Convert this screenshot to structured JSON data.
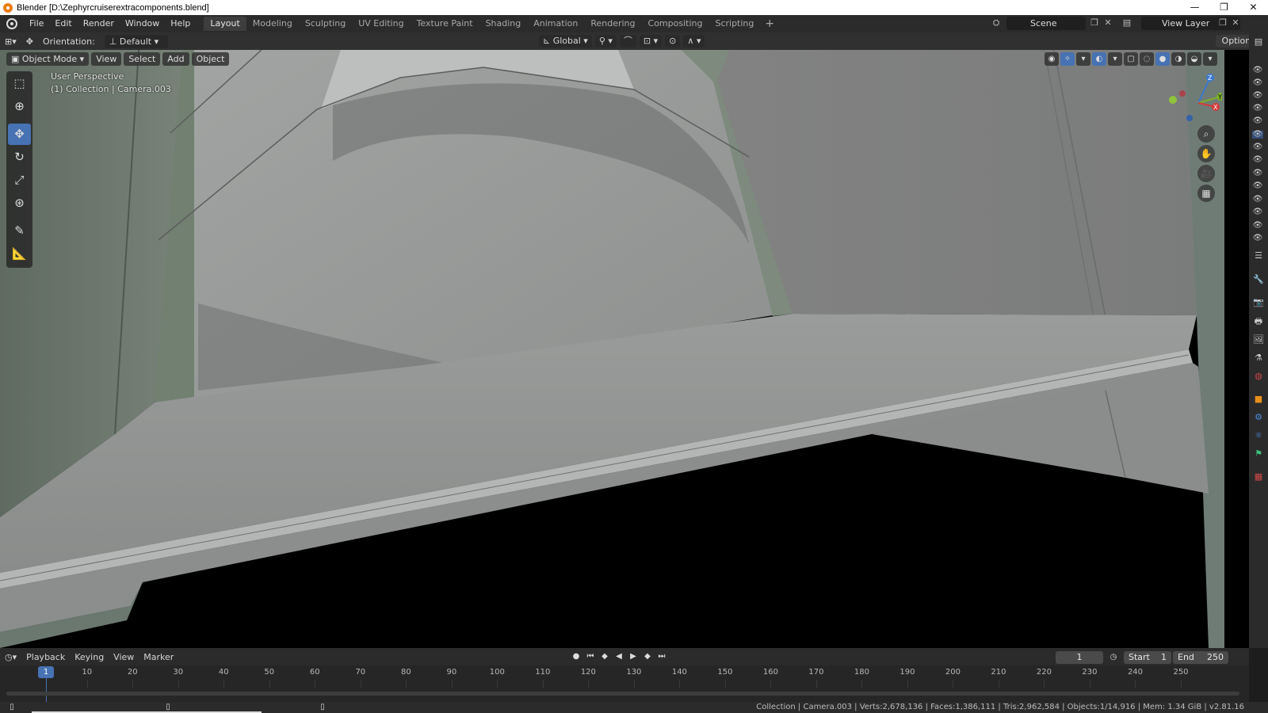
{
  "window": {
    "title": "Blender [D:\\Zephyrcruiserextracomponents.blend]",
    "controls": [
      "—",
      "❐",
      "✕"
    ]
  },
  "menu": {
    "items": [
      "File",
      "Edit",
      "Render",
      "Window",
      "Help"
    ]
  },
  "workspaces": [
    "Layout",
    "Modeling",
    "Sculpting",
    "UV Editing",
    "Texture Paint",
    "Shading",
    "Animation",
    "Rendering",
    "Compositing",
    "Scripting"
  ],
  "workspace_add": "+",
  "scene": {
    "label": "Scene"
  },
  "view_layer": {
    "label": "View Layer"
  },
  "tool_header": {
    "orientation_label": "Orientation:",
    "orientation_value": "Default",
    "transform_space": "Global",
    "options": "Options"
  },
  "viewport": {
    "mode": "Object Mode",
    "menus": [
      "View",
      "Select",
      "Add",
      "Object"
    ],
    "perspective": "User Perspective",
    "collection_info": "(1) Collection | Camera.003",
    "gizmo_axes": {
      "z": "Z",
      "y": "Y",
      "x": "X"
    }
  },
  "tools": [
    "select-box",
    "cursor",
    "move",
    "rotate",
    "scale",
    "transform",
    "annotate",
    "measure"
  ],
  "timeline": {
    "menus": [
      "Playback",
      "Keying",
      "View",
      "Marker"
    ],
    "current_frame": "1",
    "start_label": "Start",
    "start_value": "1",
    "end_label": "End",
    "end_value": "250",
    "ticks": [
      "1",
      "10",
      "20",
      "30",
      "40",
      "50",
      "60",
      "70",
      "80",
      "90",
      "100",
      "110",
      "120",
      "130",
      "140",
      "150",
      "160",
      "170",
      "180",
      "190",
      "200",
      "210",
      "220",
      "230",
      "240",
      "250"
    ]
  },
  "status": {
    "text": "Collection | Camera.003 | Verts:2,678,136 | Faces:1,386,111 | Tris:2,962,584 | Objects:1/14,916 | Mem: 1.34 GiB | v2.81.16"
  },
  "colors": {
    "accent": "#4772b3",
    "mesh_gray": "#8f918f",
    "mesh_green": "#7e8c7d"
  }
}
